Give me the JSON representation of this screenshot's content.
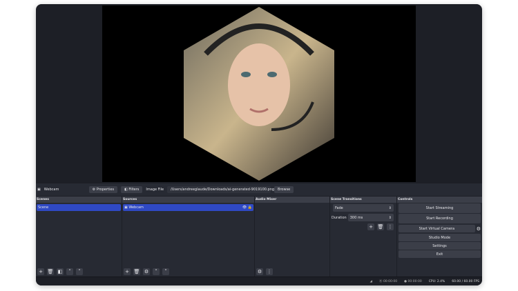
{
  "source_bar": {
    "source_name": "Webcam",
    "properties": "Properties",
    "filters": "Filters",
    "image_file_label": "Image File",
    "image_path": "/Users/andreeglaude/Downloads/ai-generated-9019100.png",
    "browse": "Browse"
  },
  "scenes": {
    "title": "Scenes",
    "items": [
      "Scene"
    ]
  },
  "sources": {
    "title": "Sources",
    "items": [
      "Webcam"
    ]
  },
  "audio_mixer": {
    "title": "Audio Mixer"
  },
  "transitions": {
    "title": "Scene Transitions",
    "type": "Fade",
    "duration_label": "Duration",
    "duration": "300 ms"
  },
  "controls": {
    "title": "Controls",
    "start_streaming": "Start Streaming",
    "start_recording": "Start Recording",
    "start_virtual_camera": "Start Virtual Camera",
    "studio_mode": "Studio Mode",
    "settings": "Settings",
    "exit": "Exit"
  },
  "status": {
    "stream_time": "00:00:00",
    "record_time": "00:00:00",
    "cpu": "CPU: 2.4%",
    "fps": "60.00 / 60.00 FPS"
  }
}
